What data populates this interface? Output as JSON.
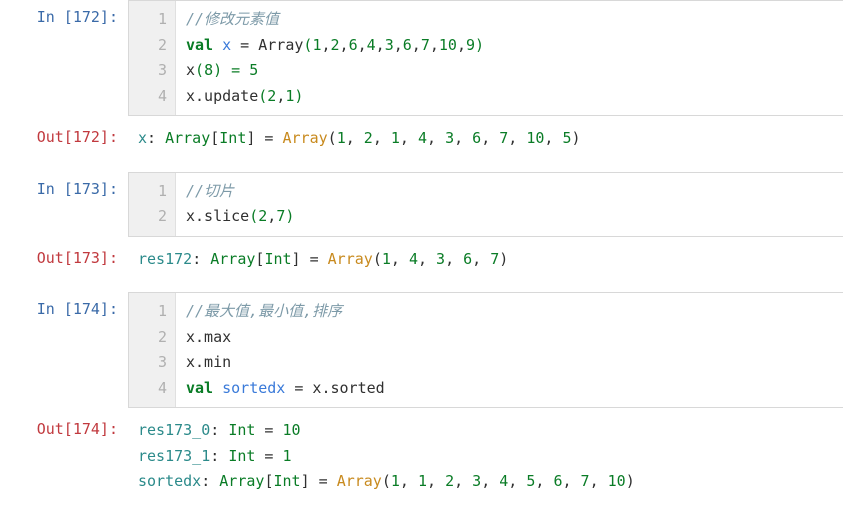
{
  "cells": [
    {
      "in_label": "In  [172]:",
      "out_label": "Out[172]:",
      "code_lines": [
        {
          "n": "1",
          "seg": [
            {
              "c": "cm",
              "t": "//修改元素值"
            }
          ]
        },
        {
          "n": "2",
          "seg": [
            {
              "c": "kw",
              "t": "val "
            },
            {
              "c": "vn",
              "t": "x"
            },
            {
              "c": "fn",
              "t": " = Array"
            },
            {
              "c": "pn",
              "t": "("
            },
            {
              "c": "nm",
              "t": "1"
            },
            {
              "c": "fn",
              "t": ","
            },
            {
              "c": "nm",
              "t": "2"
            },
            {
              "c": "fn",
              "t": ","
            },
            {
              "c": "nm",
              "t": "6"
            },
            {
              "c": "fn",
              "t": ","
            },
            {
              "c": "nm",
              "t": "4"
            },
            {
              "c": "fn",
              "t": ","
            },
            {
              "c": "nm",
              "t": "3"
            },
            {
              "c": "fn",
              "t": ","
            },
            {
              "c": "nm",
              "t": "6"
            },
            {
              "c": "fn",
              "t": ","
            },
            {
              "c": "nm",
              "t": "7"
            },
            {
              "c": "fn",
              "t": ","
            },
            {
              "c": "nm",
              "t": "10"
            },
            {
              "c": "fn",
              "t": ","
            },
            {
              "c": "nm",
              "t": "9"
            },
            {
              "c": "pn",
              "t": ")"
            }
          ]
        },
        {
          "n": "3",
          "seg": [
            {
              "c": "fn",
              "t": "x"
            },
            {
              "c": "pn",
              "t": "("
            },
            {
              "c": "nm",
              "t": "8"
            },
            {
              "c": "pn",
              "t": ")"
            },
            {
              "c": "op",
              "t": " = "
            },
            {
              "c": "nm",
              "t": "5"
            }
          ]
        },
        {
          "n": "4",
          "seg": [
            {
              "c": "fn",
              "t": "x.update"
            },
            {
              "c": "pn",
              "t": "("
            },
            {
              "c": "nm",
              "t": "2"
            },
            {
              "c": "fn",
              "t": ","
            },
            {
              "c": "nm",
              "t": "1"
            },
            {
              "c": "pn",
              "t": ")"
            }
          ]
        }
      ],
      "out_lines": [
        [
          {
            "c": "rn",
            "t": "x"
          },
          {
            "c": "fn",
            "t": ": "
          },
          {
            "c": "tp",
            "t": "Array"
          },
          {
            "c": "fn",
            "t": "["
          },
          {
            "c": "tp",
            "t": "Int"
          },
          {
            "c": "fn",
            "t": "] = "
          },
          {
            "c": "ar",
            "t": "Array"
          },
          {
            "c": "fn",
            "t": "("
          },
          {
            "c": "nm",
            "t": "1"
          },
          {
            "c": "fn",
            "t": ", "
          },
          {
            "c": "nm",
            "t": "2"
          },
          {
            "c": "fn",
            "t": ", "
          },
          {
            "c": "nm",
            "t": "1"
          },
          {
            "c": "fn",
            "t": ", "
          },
          {
            "c": "nm",
            "t": "4"
          },
          {
            "c": "fn",
            "t": ", "
          },
          {
            "c": "nm",
            "t": "3"
          },
          {
            "c": "fn",
            "t": ", "
          },
          {
            "c": "nm",
            "t": "6"
          },
          {
            "c": "fn",
            "t": ", "
          },
          {
            "c": "nm",
            "t": "7"
          },
          {
            "c": "fn",
            "t": ", "
          },
          {
            "c": "nm",
            "t": "10"
          },
          {
            "c": "fn",
            "t": ", "
          },
          {
            "c": "nm",
            "t": "5"
          },
          {
            "c": "fn",
            "t": ")"
          }
        ]
      ]
    },
    {
      "in_label": "In  [173]:",
      "out_label": "Out[173]:",
      "code_lines": [
        {
          "n": "1",
          "seg": [
            {
              "c": "cm",
              "t": "//切片"
            }
          ]
        },
        {
          "n": "2",
          "seg": [
            {
              "c": "fn",
              "t": "x.slice"
            },
            {
              "c": "pn",
              "t": "("
            },
            {
              "c": "nm",
              "t": "2"
            },
            {
              "c": "fn",
              "t": ","
            },
            {
              "c": "nm",
              "t": "7"
            },
            {
              "c": "pn",
              "t": ")"
            }
          ]
        }
      ],
      "out_lines": [
        [
          {
            "c": "rn",
            "t": "res172"
          },
          {
            "c": "fn",
            "t": ": "
          },
          {
            "c": "tp",
            "t": "Array"
          },
          {
            "c": "fn",
            "t": "["
          },
          {
            "c": "tp",
            "t": "Int"
          },
          {
            "c": "fn",
            "t": "] = "
          },
          {
            "c": "ar",
            "t": "Array"
          },
          {
            "c": "fn",
            "t": "("
          },
          {
            "c": "nm",
            "t": "1"
          },
          {
            "c": "fn",
            "t": ", "
          },
          {
            "c": "nm",
            "t": "4"
          },
          {
            "c": "fn",
            "t": ", "
          },
          {
            "c": "nm",
            "t": "3"
          },
          {
            "c": "fn",
            "t": ", "
          },
          {
            "c": "nm",
            "t": "6"
          },
          {
            "c": "fn",
            "t": ", "
          },
          {
            "c": "nm",
            "t": "7"
          },
          {
            "c": "fn",
            "t": ")"
          }
        ]
      ]
    },
    {
      "in_label": "In  [174]:",
      "out_label": "Out[174]:",
      "code_lines": [
        {
          "n": "1",
          "seg": [
            {
              "c": "cm",
              "t": "//最大值,最小值,排序"
            }
          ]
        },
        {
          "n": "2",
          "seg": [
            {
              "c": "fn",
              "t": "x.max"
            }
          ]
        },
        {
          "n": "3",
          "seg": [
            {
              "c": "fn",
              "t": "x.min"
            }
          ]
        },
        {
          "n": "4",
          "seg": [
            {
              "c": "kw",
              "t": "val "
            },
            {
              "c": "vn",
              "t": "sortedx"
            },
            {
              "c": "fn",
              "t": " = x.sorted"
            }
          ]
        }
      ],
      "out_lines": [
        [
          {
            "c": "rn",
            "t": "res173_0"
          },
          {
            "c": "fn",
            "t": ": "
          },
          {
            "c": "tp",
            "t": "Int"
          },
          {
            "c": "fn",
            "t": " = "
          },
          {
            "c": "nm",
            "t": "10"
          }
        ],
        [
          {
            "c": "rn",
            "t": "res173_1"
          },
          {
            "c": "fn",
            "t": ": "
          },
          {
            "c": "tp",
            "t": "Int"
          },
          {
            "c": "fn",
            "t": " = "
          },
          {
            "c": "nm",
            "t": "1"
          }
        ],
        [
          {
            "c": "rn",
            "t": "sortedx"
          },
          {
            "c": "fn",
            "t": ": "
          },
          {
            "c": "tp",
            "t": "Array"
          },
          {
            "c": "fn",
            "t": "["
          },
          {
            "c": "tp",
            "t": "Int"
          },
          {
            "c": "fn",
            "t": "] = "
          },
          {
            "c": "ar",
            "t": "Array"
          },
          {
            "c": "fn",
            "t": "("
          },
          {
            "c": "nm",
            "t": "1"
          },
          {
            "c": "fn",
            "t": ", "
          },
          {
            "c": "nm",
            "t": "1"
          },
          {
            "c": "fn",
            "t": ", "
          },
          {
            "c": "nm",
            "t": "2"
          },
          {
            "c": "fn",
            "t": ", "
          },
          {
            "c": "nm",
            "t": "3"
          },
          {
            "c": "fn",
            "t": ", "
          },
          {
            "c": "nm",
            "t": "4"
          },
          {
            "c": "fn",
            "t": ", "
          },
          {
            "c": "nm",
            "t": "5"
          },
          {
            "c": "fn",
            "t": ", "
          },
          {
            "c": "nm",
            "t": "6"
          },
          {
            "c": "fn",
            "t": ", "
          },
          {
            "c": "nm",
            "t": "7"
          },
          {
            "c": "fn",
            "t": ", "
          },
          {
            "c": "nm",
            "t": "10"
          },
          {
            "c": "fn",
            "t": ")"
          }
        ]
      ]
    }
  ]
}
